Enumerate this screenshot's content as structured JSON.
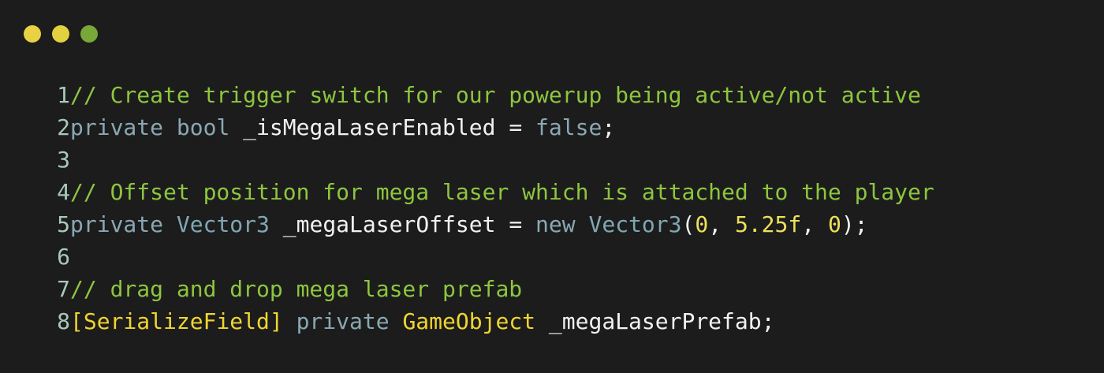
{
  "window": {
    "traffic_lights": [
      {
        "name": "close",
        "color": "#e8d143"
      },
      {
        "name": "minimize",
        "color": "#e3d13f"
      },
      {
        "name": "maximize",
        "color": "#78a83a"
      }
    ]
  },
  "colors": {
    "background": "#1c1c1c",
    "line_number": "#a9c8b9",
    "comment": "#8dc63f",
    "keyword": "#8aa8b4",
    "type": "#7fa8b3",
    "identifier": "#f1f1f1",
    "number": "#eee05a",
    "attribute": "#f0d530",
    "punct": "#f1f1f1"
  },
  "code": {
    "lines": [
      {
        "n": "1",
        "tokens": [
          {
            "t": "// Create trigger switch for our powerup being active/not active",
            "c": "comment"
          }
        ]
      },
      {
        "n": "2",
        "tokens": [
          {
            "t": "private",
            "c": "keyword"
          },
          {
            "t": " ",
            "c": "punct"
          },
          {
            "t": "bool",
            "c": "keyword"
          },
          {
            "t": " _isMegaLaserEnabled = ",
            "c": "identifier"
          },
          {
            "t": "false",
            "c": "keyword"
          },
          {
            "t": ";",
            "c": "punct"
          }
        ]
      },
      {
        "n": "3",
        "tokens": []
      },
      {
        "n": "4",
        "tokens": [
          {
            "t": "// Offset position for mega laser which is attached to the player",
            "c": "comment"
          }
        ]
      },
      {
        "n": "5",
        "tokens": [
          {
            "t": "private",
            "c": "keyword"
          },
          {
            "t": " ",
            "c": "punct"
          },
          {
            "t": "Vector3",
            "c": "type"
          },
          {
            "t": " _megaLaserOffset = ",
            "c": "identifier"
          },
          {
            "t": "new",
            "c": "keyword"
          },
          {
            "t": " ",
            "c": "punct"
          },
          {
            "t": "Vector3",
            "c": "type"
          },
          {
            "t": "(",
            "c": "punct"
          },
          {
            "t": "0",
            "c": "number"
          },
          {
            "t": ", ",
            "c": "punct"
          },
          {
            "t": "5.25f",
            "c": "number"
          },
          {
            "t": ", ",
            "c": "punct"
          },
          {
            "t": "0",
            "c": "number"
          },
          {
            "t": ");",
            "c": "punct"
          }
        ]
      },
      {
        "n": "6",
        "tokens": []
      },
      {
        "n": "7",
        "tokens": [
          {
            "t": "// drag and drop mega laser prefab",
            "c": "comment"
          }
        ]
      },
      {
        "n": "8",
        "tokens": [
          {
            "t": "[SerializeField]",
            "c": "attribute"
          },
          {
            "t": " ",
            "c": "punct"
          },
          {
            "t": "private",
            "c": "keyword"
          },
          {
            "t": " ",
            "c": "punct"
          },
          {
            "t": "GameObject",
            "c": "attribute"
          },
          {
            "t": " _megaLaserPrefab;",
            "c": "identifier"
          }
        ]
      }
    ]
  }
}
